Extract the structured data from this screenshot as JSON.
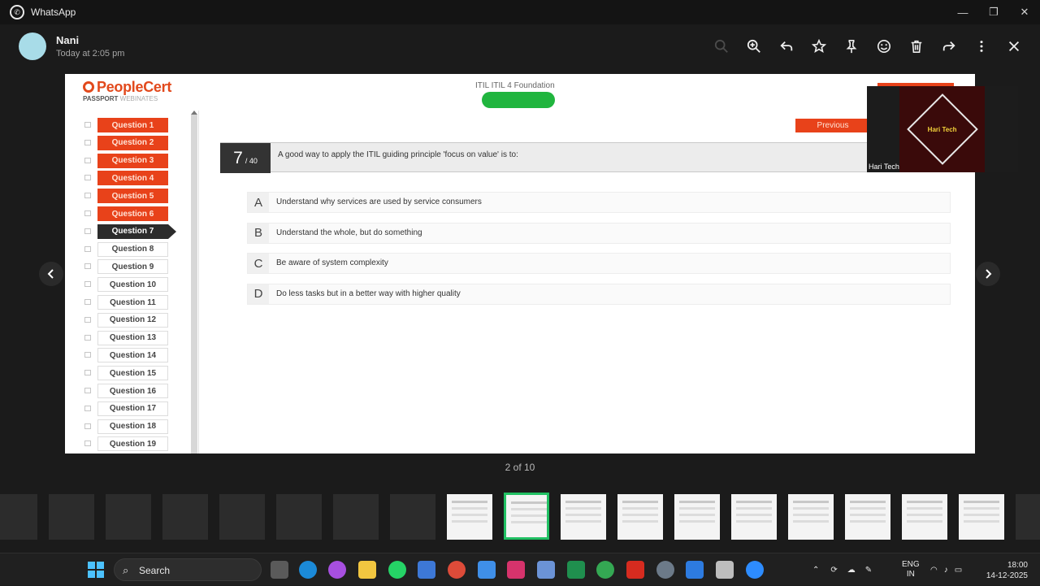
{
  "window": {
    "title": "WhatsApp"
  },
  "header": {
    "sender": "Nani",
    "timestamp": "Today at 2:05 pm"
  },
  "exam": {
    "brand": "PeopleCert",
    "sub_brand": "PASSPORT",
    "sub_brand_suffix": "WEBINATES",
    "title": "ITIL ITIL 4 Foundation",
    "previous_label": "Previous",
    "question_number": "7",
    "question_total": "/ 40",
    "question_text": "A good way to apply the ITIL guiding principle 'focus on value' is to:",
    "questions": [
      {
        "label": "Question 1",
        "state": "done"
      },
      {
        "label": "Question 2",
        "state": "done"
      },
      {
        "label": "Question 3",
        "state": "done"
      },
      {
        "label": "Question 4",
        "state": "done"
      },
      {
        "label": "Question 5",
        "state": "done"
      },
      {
        "label": "Question 6",
        "state": "done"
      },
      {
        "label": "Question 7",
        "state": "current"
      },
      {
        "label": "Question 8",
        "state": "todo"
      },
      {
        "label": "Question 9",
        "state": "todo"
      },
      {
        "label": "Question 10",
        "state": "todo"
      },
      {
        "label": "Question 11",
        "state": "todo"
      },
      {
        "label": "Question 12",
        "state": "todo"
      },
      {
        "label": "Question 13",
        "state": "todo"
      },
      {
        "label": "Question 14",
        "state": "todo"
      },
      {
        "label": "Question 15",
        "state": "todo"
      },
      {
        "label": "Question 16",
        "state": "todo"
      },
      {
        "label": "Question 17",
        "state": "todo"
      },
      {
        "label": "Question 18",
        "state": "todo"
      },
      {
        "label": "Question 19",
        "state": "todo"
      }
    ],
    "answers": [
      {
        "letter": "A",
        "text": "Understand why services are used by service consumers"
      },
      {
        "letter": "B",
        "text": "Understand the whole, but do something"
      },
      {
        "letter": "C",
        "text": "Be aware of system complexity"
      },
      {
        "letter": "D",
        "text": "Do less tasks but in a better way with higher quality"
      }
    ]
  },
  "webcam": {
    "logo_text": "Hari Tech",
    "label": "Hari Tech"
  },
  "viewer": {
    "counter": "2 of 10"
  },
  "taskbar": {
    "search_label": "Search",
    "lang_line1": "ENG",
    "lang_line2": "IN",
    "time": "18:00",
    "date": "14-12-2025"
  },
  "colors": {
    "accent_orange": "#e8421a",
    "whatsapp_green": "#21c063"
  }
}
